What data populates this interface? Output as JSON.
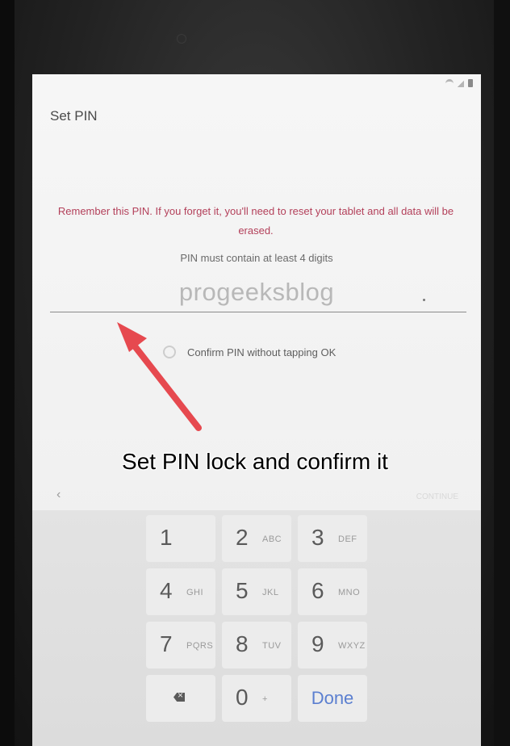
{
  "screen": {
    "title": "Set PIN",
    "warning": "Remember this PIN. If you forget it, you'll need to reset your tablet and all data will be erased.",
    "hint": "PIN must contain at least 4 digits",
    "watermark": "progeeksblog",
    "confirm_option": {
      "label": "Confirm PIN without tapping OK",
      "checked": false
    },
    "back_label": "‹",
    "continue_label": "CONTINUE"
  },
  "overlay": {
    "caption": "Set PIN lock and confirm it"
  },
  "keypad": {
    "keys": [
      {
        "num": "1",
        "letters": ""
      },
      {
        "num": "2",
        "letters": "ABC"
      },
      {
        "num": "3",
        "letters": "DEF"
      },
      {
        "num": "4",
        "letters": "GHI"
      },
      {
        "num": "5",
        "letters": "JKL"
      },
      {
        "num": "6",
        "letters": "MNO"
      },
      {
        "num": "7",
        "letters": "PQRS"
      },
      {
        "num": "8",
        "letters": "TUV"
      },
      {
        "num": "9",
        "letters": "WXYZ"
      },
      {
        "num": "0",
        "letters": "+"
      }
    ],
    "backspace_icon": "backspace-icon",
    "done_label": "Done"
  },
  "colors": {
    "warning": "#b3405a",
    "done": "#5b7fd0",
    "arrow": "#e6494f"
  }
}
